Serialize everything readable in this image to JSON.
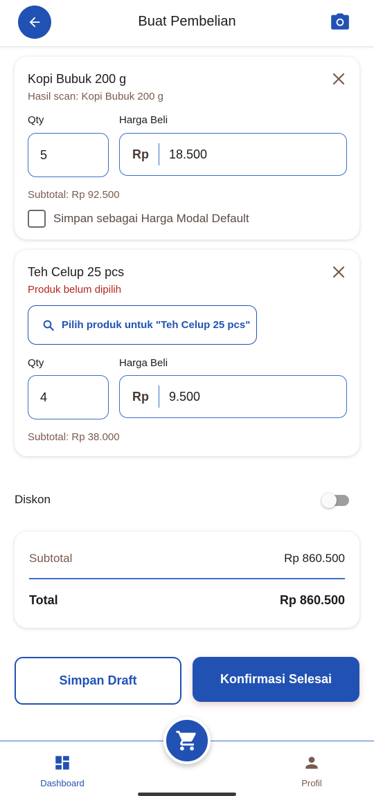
{
  "header": {
    "title": "Buat Pembelian",
    "back_icon": "arrow-left-icon",
    "camera_icon": "camera-icon"
  },
  "items": [
    {
      "name": "Kopi Bubuk 200 g",
      "subtitle": "Hasil scan: Kopi Bubuk 200 g",
      "qty_label": "Qty",
      "price_label": "Harga Beli",
      "qty": "5",
      "currency": "Rp",
      "price": "18.500",
      "subtotal": "Subtotal: Rp 92.500",
      "checkbox_label": "Simpan sebagai Harga Modal Default",
      "checkbox_checked": false
    },
    {
      "name": "Teh Celup 25 pcs",
      "subtitle": "Produk belum dipilih",
      "pick_label": "Pilih produk untuk \"Teh Celup 25 pcs\"",
      "qty_label": "Qty",
      "price_label": "Harga Beli",
      "qty": "4",
      "currency": "Rp",
      "price": "9.500",
      "subtotal": "Subtotal: Rp 38.000"
    }
  ],
  "discount": {
    "label": "Diskon",
    "enabled": false
  },
  "summary": {
    "subtotal_label": "Subtotal",
    "subtotal_value": "Rp 860.500",
    "total_label": "Total",
    "total_value": "Rp 860.500"
  },
  "actions": {
    "draft_label": "Simpan Draft",
    "confirm_label": "Konfirmasi Selesai"
  },
  "bottom_nav": {
    "dashboard_label": "Dashboard",
    "profil_label": "Profil",
    "center_icon": "cart-icon"
  },
  "colors": {
    "primary": "#2152b3",
    "error": "#b3261e",
    "muted_text": "#7a5a4e"
  }
}
